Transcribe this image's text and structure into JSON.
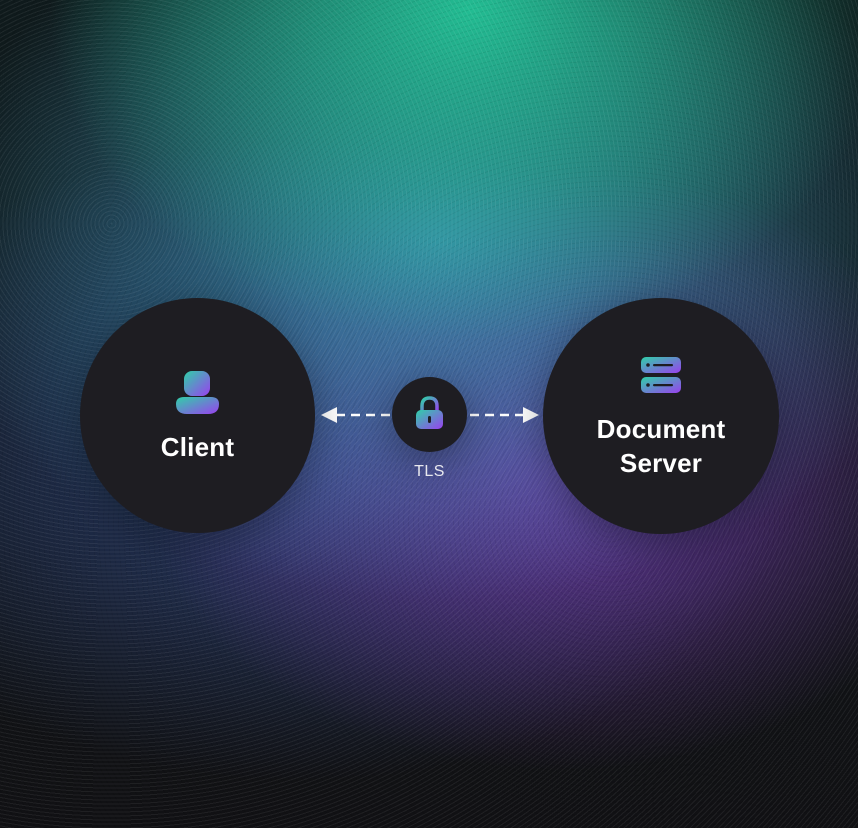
{
  "diagram": {
    "client": {
      "label": "Client",
      "icon": "user-icon"
    },
    "server": {
      "label_line1": "Document",
      "label_line2": "Server",
      "icon": "server-stack-icon"
    },
    "connection": {
      "label": "TLS",
      "icon": "lock-icon",
      "direction": "bidirectional"
    },
    "colors": {
      "node_fill": "#1e1d22",
      "icon_gradient_start": "#2fd0a8",
      "icon_gradient_end": "#9a40f0",
      "text": "#ffffff",
      "arrow": "#ffffff"
    }
  }
}
